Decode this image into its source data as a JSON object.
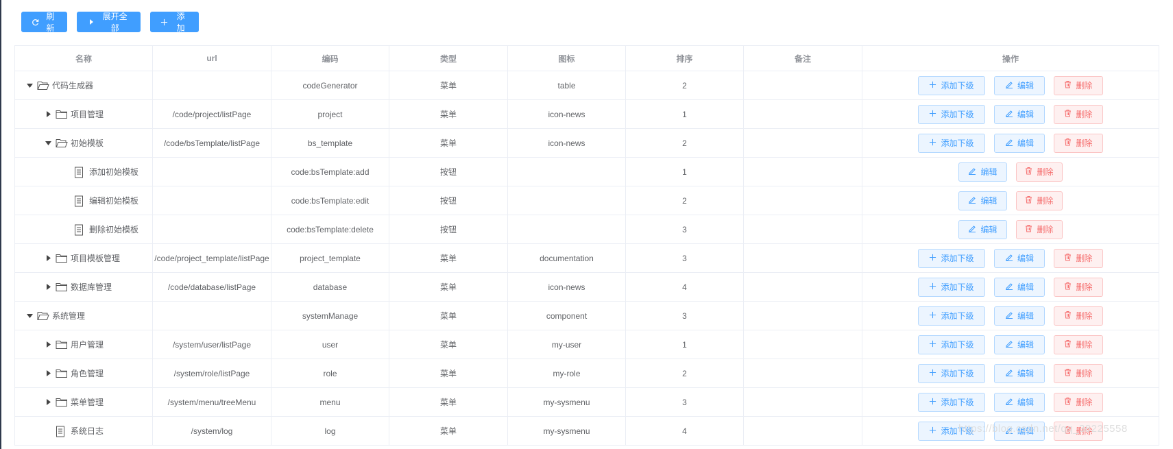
{
  "toolbar": {
    "refresh_label": "刷新",
    "expand_label": "展开全部",
    "add_label": "添加"
  },
  "table": {
    "headers": [
      "名称",
      "url",
      "编码",
      "类型",
      "图标",
      "排序",
      "备注",
      "操作"
    ],
    "rows": [
      {
        "level": 0,
        "kind": "folder",
        "expand": "expanded",
        "name": "代码生成器",
        "url": "",
        "code": "codeGenerator",
        "type": "菜单",
        "icon": "table",
        "sort": "2",
        "remark": "",
        "actions": "full"
      },
      {
        "level": 1,
        "kind": "folder",
        "expand": "collapsed",
        "name": "项目管理",
        "url": "/code/project/listPage",
        "code": "project",
        "type": "菜单",
        "icon": "icon-news",
        "sort": "1",
        "remark": "",
        "actions": "full"
      },
      {
        "level": 1,
        "kind": "folder",
        "expand": "expanded",
        "name": "初始模板",
        "url": "/code/bsTemplate/listPage",
        "code": "bs_template",
        "type": "菜单",
        "icon": "icon-news",
        "sort": "2",
        "remark": "",
        "actions": "full"
      },
      {
        "level": 2,
        "kind": "file",
        "expand": "none",
        "name": "添加初始模板",
        "url": "",
        "code": "code:bsTemplate:add",
        "type": "按钮",
        "icon": "",
        "sort": "1",
        "remark": "",
        "actions": "edit-delete"
      },
      {
        "level": 2,
        "kind": "file",
        "expand": "none",
        "name": "编辑初始模板",
        "url": "",
        "code": "code:bsTemplate:edit",
        "type": "按钮",
        "icon": "",
        "sort": "2",
        "remark": "",
        "actions": "edit-delete"
      },
      {
        "level": 2,
        "kind": "file",
        "expand": "none",
        "name": "删除初始模板",
        "url": "",
        "code": "code:bsTemplate:delete",
        "type": "按钮",
        "icon": "",
        "sort": "3",
        "remark": "",
        "actions": "edit-delete"
      },
      {
        "level": 1,
        "kind": "folder",
        "expand": "collapsed",
        "name": "项目模板管理",
        "url": "/code/project_template/listPage",
        "code": "project_template",
        "type": "菜单",
        "icon": "documentation",
        "sort": "3",
        "remark": "",
        "actions": "full"
      },
      {
        "level": 1,
        "kind": "folder",
        "expand": "collapsed",
        "name": "数据库管理",
        "url": "/code/database/listPage",
        "code": "database",
        "type": "菜单",
        "icon": "icon-news",
        "sort": "4",
        "remark": "",
        "actions": "full"
      },
      {
        "level": 0,
        "kind": "folder",
        "expand": "expanded",
        "name": "系统管理",
        "url": "",
        "code": "systemManage",
        "type": "菜单",
        "icon": "component",
        "sort": "3",
        "remark": "",
        "actions": "full"
      },
      {
        "level": 1,
        "kind": "folder",
        "expand": "collapsed",
        "name": "用户管理",
        "url": "/system/user/listPage",
        "code": "user",
        "type": "菜单",
        "icon": "my-user",
        "sort": "1",
        "remark": "",
        "actions": "full"
      },
      {
        "level": 1,
        "kind": "folder",
        "expand": "collapsed",
        "name": "角色管理",
        "url": "/system/role/listPage",
        "code": "role",
        "type": "菜单",
        "icon": "my-role",
        "sort": "2",
        "remark": "",
        "actions": "full"
      },
      {
        "level": 1,
        "kind": "folder",
        "expand": "collapsed",
        "name": "菜单管理",
        "url": "/system/menu/treeMenu",
        "code": "menu",
        "type": "菜单",
        "icon": "my-sysmenu",
        "sort": "3",
        "remark": "",
        "actions": "full"
      },
      {
        "level": 1,
        "kind": "file",
        "expand": "none",
        "name": "系统日志",
        "url": "/system/log",
        "code": "log",
        "type": "菜单",
        "icon": "my-sysmenu",
        "sort": "4",
        "remark": "",
        "actions": "full"
      }
    ]
  },
  "row_actions": {
    "add_child_label": "添加下级",
    "edit_label": "编辑",
    "delete_label": "删除"
  },
  "watermark": "https://blog.csdn.net/qq_38225558",
  "colors": {
    "primary": "#409eff",
    "primary_plain_bg": "#ecf5ff",
    "danger": "#f56c6c",
    "danger_plain_bg": "#fef0f0",
    "border": "#ebeef5",
    "header_text": "#909399",
    "body_text": "#606266"
  }
}
